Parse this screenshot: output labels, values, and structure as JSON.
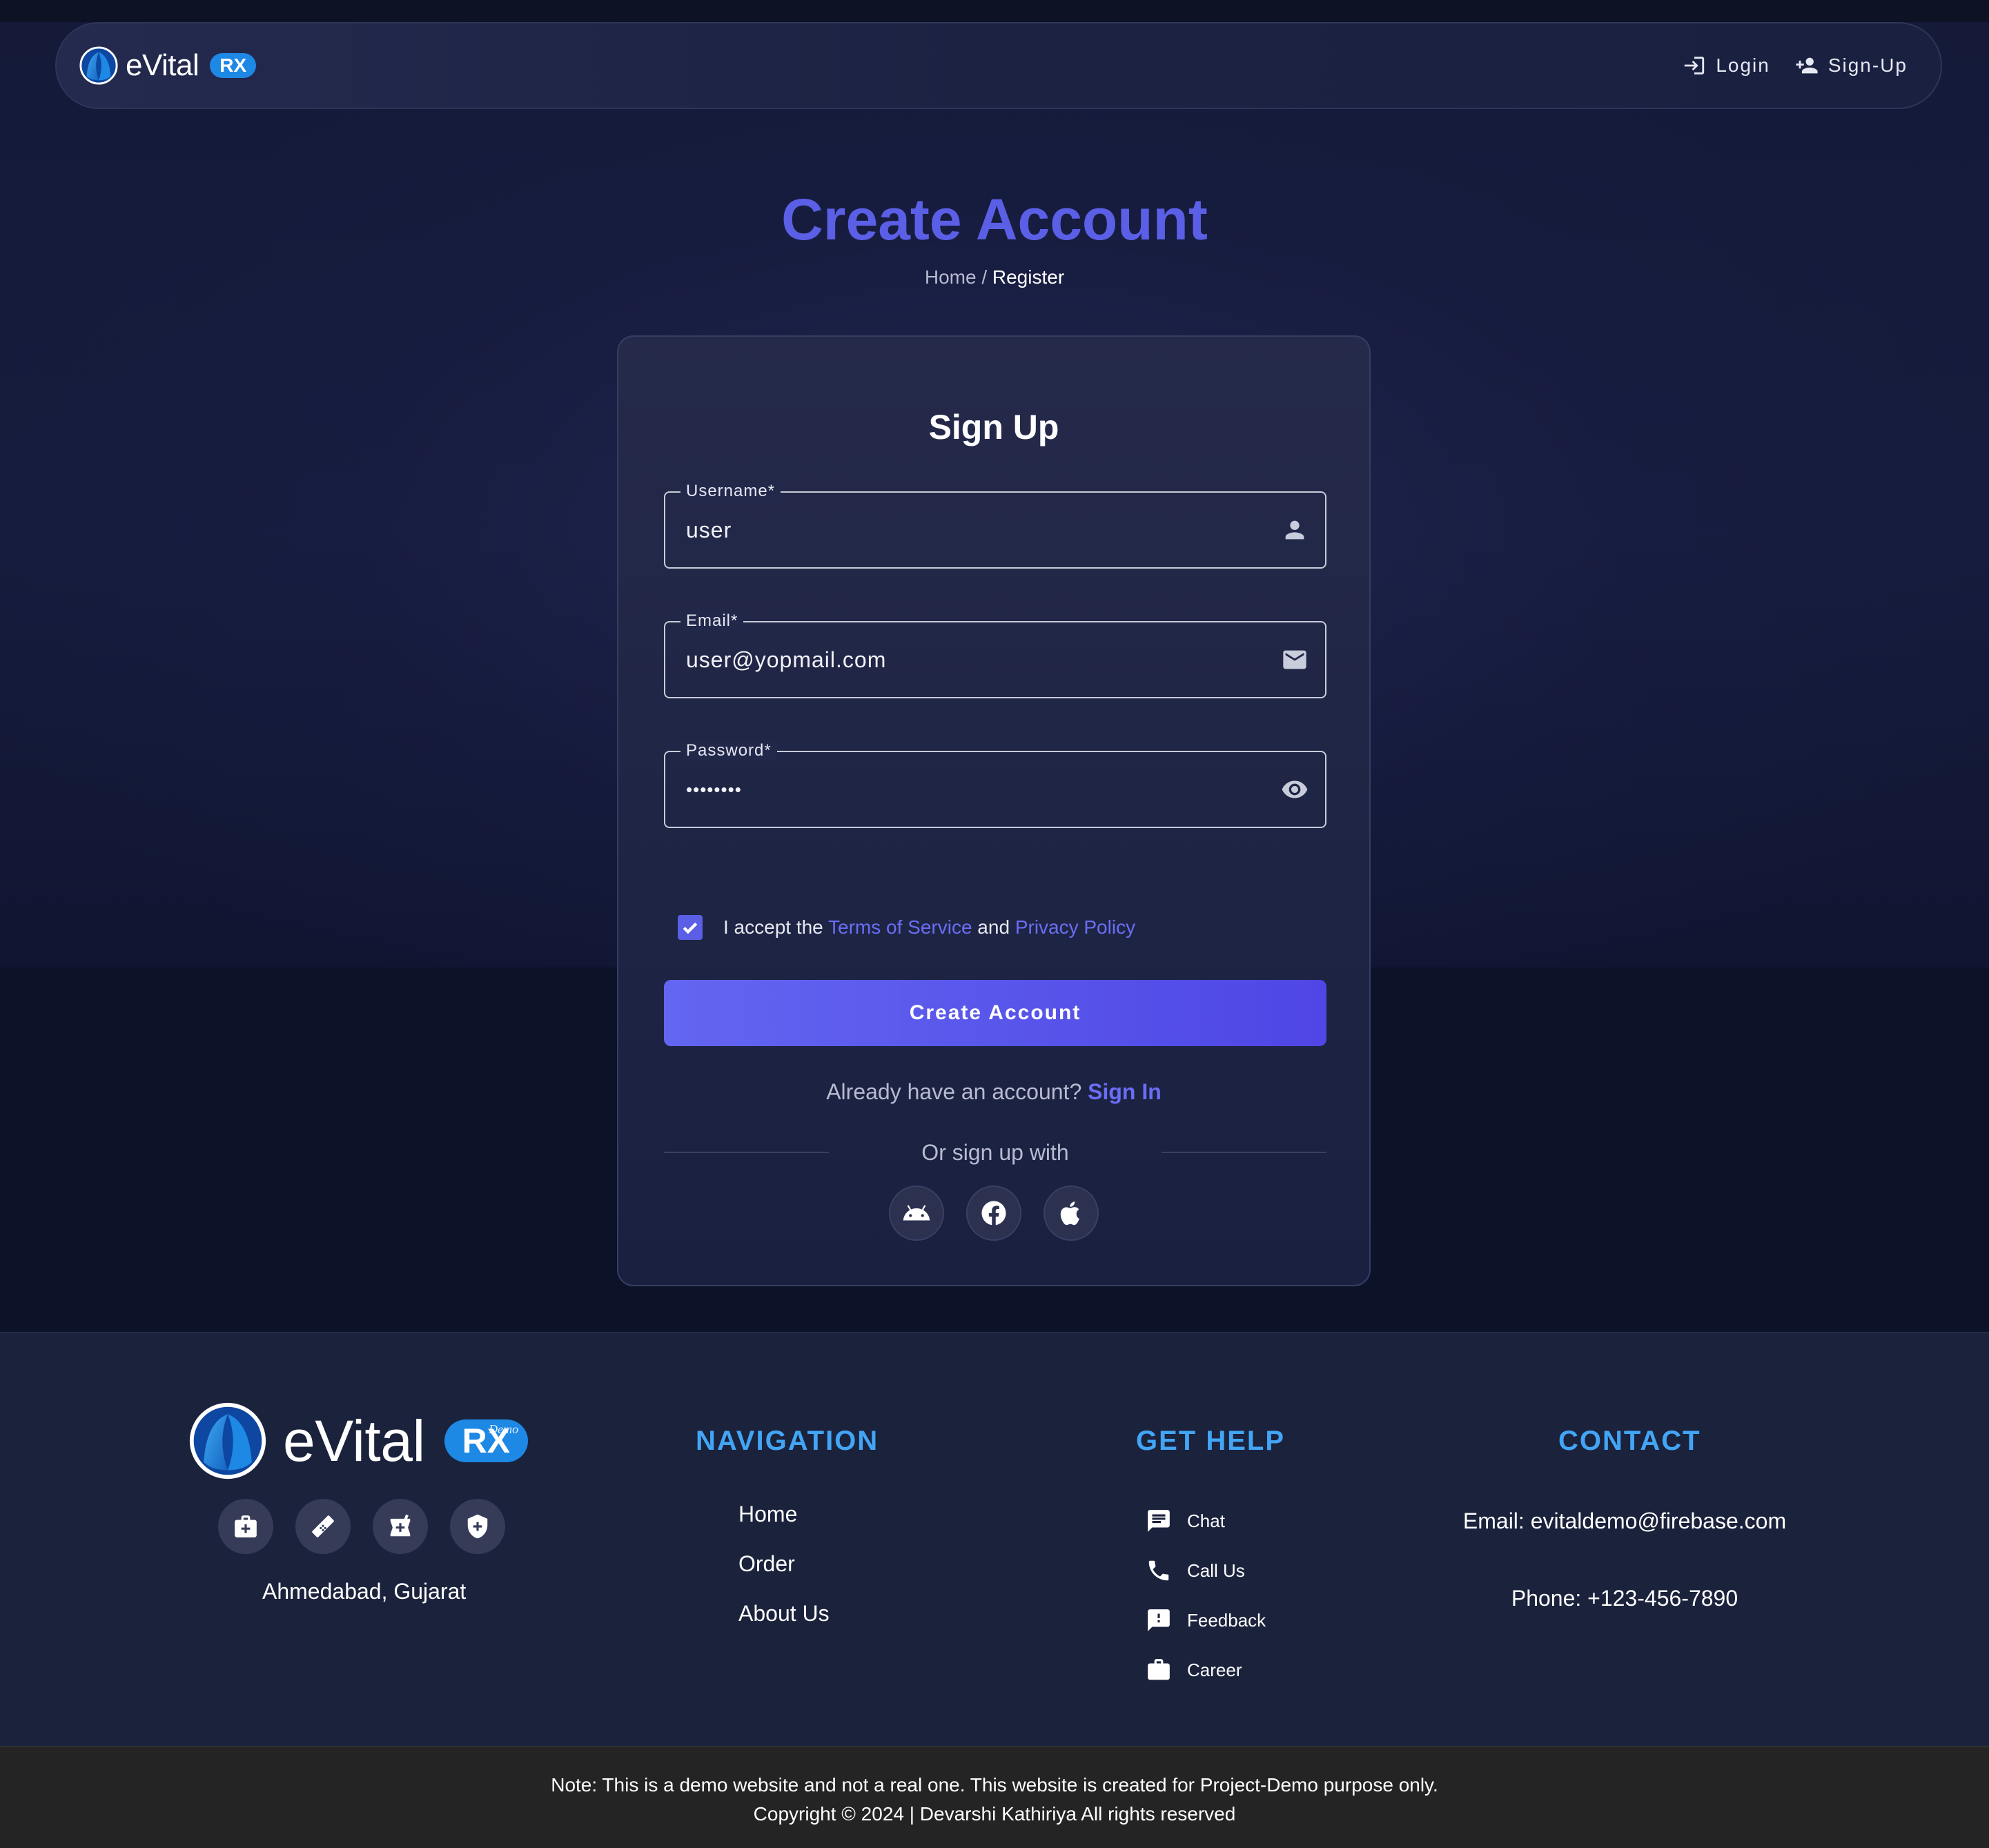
{
  "header": {
    "brand": "eVital",
    "badge": "RX",
    "login_label": "Login",
    "signup_label": "Sign-Up"
  },
  "page": {
    "title": "Create Account",
    "breadcrumb_home": "Home",
    "breadcrumb_sep": " / ",
    "breadcrumb_current": "Register"
  },
  "form": {
    "title": "Sign Up",
    "username_label": "Username*",
    "username_value": "user",
    "email_label": "Email*",
    "email_value": "user@yopmail.com",
    "password_label": "Password*",
    "password_value": "••••••••",
    "terms_prefix": "I accept the ",
    "terms_link": "Terms of Service",
    "terms_and": " and ",
    "privacy_link": "Privacy Policy",
    "terms_checked": true,
    "submit_label": "Create Account",
    "already_text": "Already have an account? ",
    "signin_link": "Sign In",
    "or_text": "Or sign up with",
    "social_icons": [
      "android-icon",
      "facebook-icon",
      "apple-icon"
    ]
  },
  "footer": {
    "brand": "eVital",
    "badge": "RX",
    "badge_tag": "Demo",
    "icons": [
      "medical-bag-icon",
      "bandage-icon",
      "pharmacy-icon",
      "health-shield-icon"
    ],
    "location": "Ahmedabad, Gujarat",
    "navigation_heading": "NAVIGATION",
    "navigation": [
      {
        "label": "Home"
      },
      {
        "label": "Order"
      },
      {
        "label": "About Us"
      }
    ],
    "help_heading": "GET HELP",
    "help": [
      {
        "label": "Chat",
        "icon": "chat-icon"
      },
      {
        "label": "Call Us",
        "icon": "phone-icon"
      },
      {
        "label": "Feedback",
        "icon": "feedback-icon"
      },
      {
        "label": "Career",
        "icon": "briefcase-icon"
      }
    ],
    "contact_heading": "CONTACT",
    "email": "Email: evitaldemo@firebase.com",
    "phone": "Phone: +123-456-7890"
  },
  "bottom": {
    "note": "Note: This is a demo website and not a real one. This website is created for Project-Demo purpose only.",
    "copyright": "Copyright © 2024 | Devarshi Kathiriya All rights reserved"
  },
  "colors": {
    "accent": "#5b5fe6",
    "link": "#6a6ef5",
    "footer_heading": "#42a5f5",
    "badge": "#1e88e5"
  }
}
